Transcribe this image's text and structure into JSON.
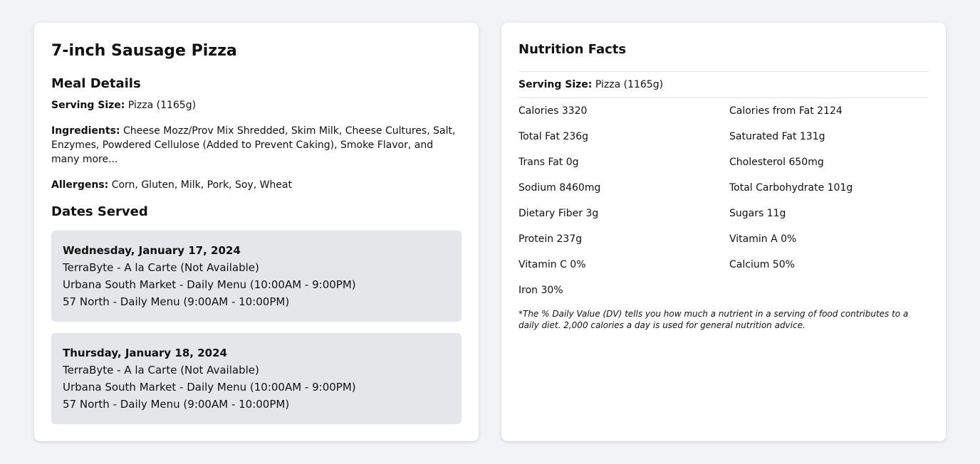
{
  "meal": {
    "title": "7-inch Sausage Pizza",
    "details_heading": "Meal Details",
    "serving_label": "Serving Size:",
    "serving_value": " Pizza (1165g)",
    "ingredients_label": "Ingredients:",
    "ingredients_value": " Cheese Mozz/Prov Mix Shredded, Skim Milk, Cheese Cultures, Salt, Enzymes, Powdered Cellulose (Added to Prevent Caking), Smoke Flavor, and many more...",
    "allergens_label": "Allergens:",
    "allergens_value": " Corn, Gluten, Milk, Pork, Soy, Wheat",
    "dates_heading": "Dates Served",
    "dates": [
      {
        "date": "Wednesday, January 17, 2024",
        "locations": [
          "TerraByte - A la Carte (Not Available)",
          "Urbana South Market - Daily Menu (10:00AM - 9:00PM)",
          "57 North - Daily Menu (9:00AM - 10:00PM)"
        ]
      },
      {
        "date": "Thursday, January 18, 2024",
        "locations": [
          "TerraByte - A la Carte (Not Available)",
          "Urbana South Market - Daily Menu (10:00AM - 9:00PM)",
          "57 North - Daily Menu (9:00AM - 10:00PM)"
        ]
      }
    ]
  },
  "nutrition": {
    "title": "Nutrition Facts",
    "serving_label": "Serving Size:",
    "serving_value": " Pizza (1165g)",
    "facts": [
      "Calories 3320",
      "Calories from Fat 2124",
      "Total Fat 236g",
      "Saturated Fat 131g",
      "Trans Fat 0g",
      "Cholesterol 650mg",
      "Sodium 8460mg",
      "Total Carbohydrate 101g",
      "Dietary Fiber 3g",
      "Sugars 11g",
      "Protein 237g",
      "Vitamin A 0%",
      "Vitamin C 0%",
      "Calcium 50%",
      "Iron 30%"
    ],
    "note": "*The % Daily Value (DV) tells you how much a nutrient in a serving of food contributes to a daily diet. 2,000 calories a day is used for general nutrition advice."
  },
  "colors": {
    "page_background": "#f2f3f5",
    "card_background": "#ffffff",
    "date_box_background": "#e4e6ea",
    "divider": "#e2e4e8"
  }
}
